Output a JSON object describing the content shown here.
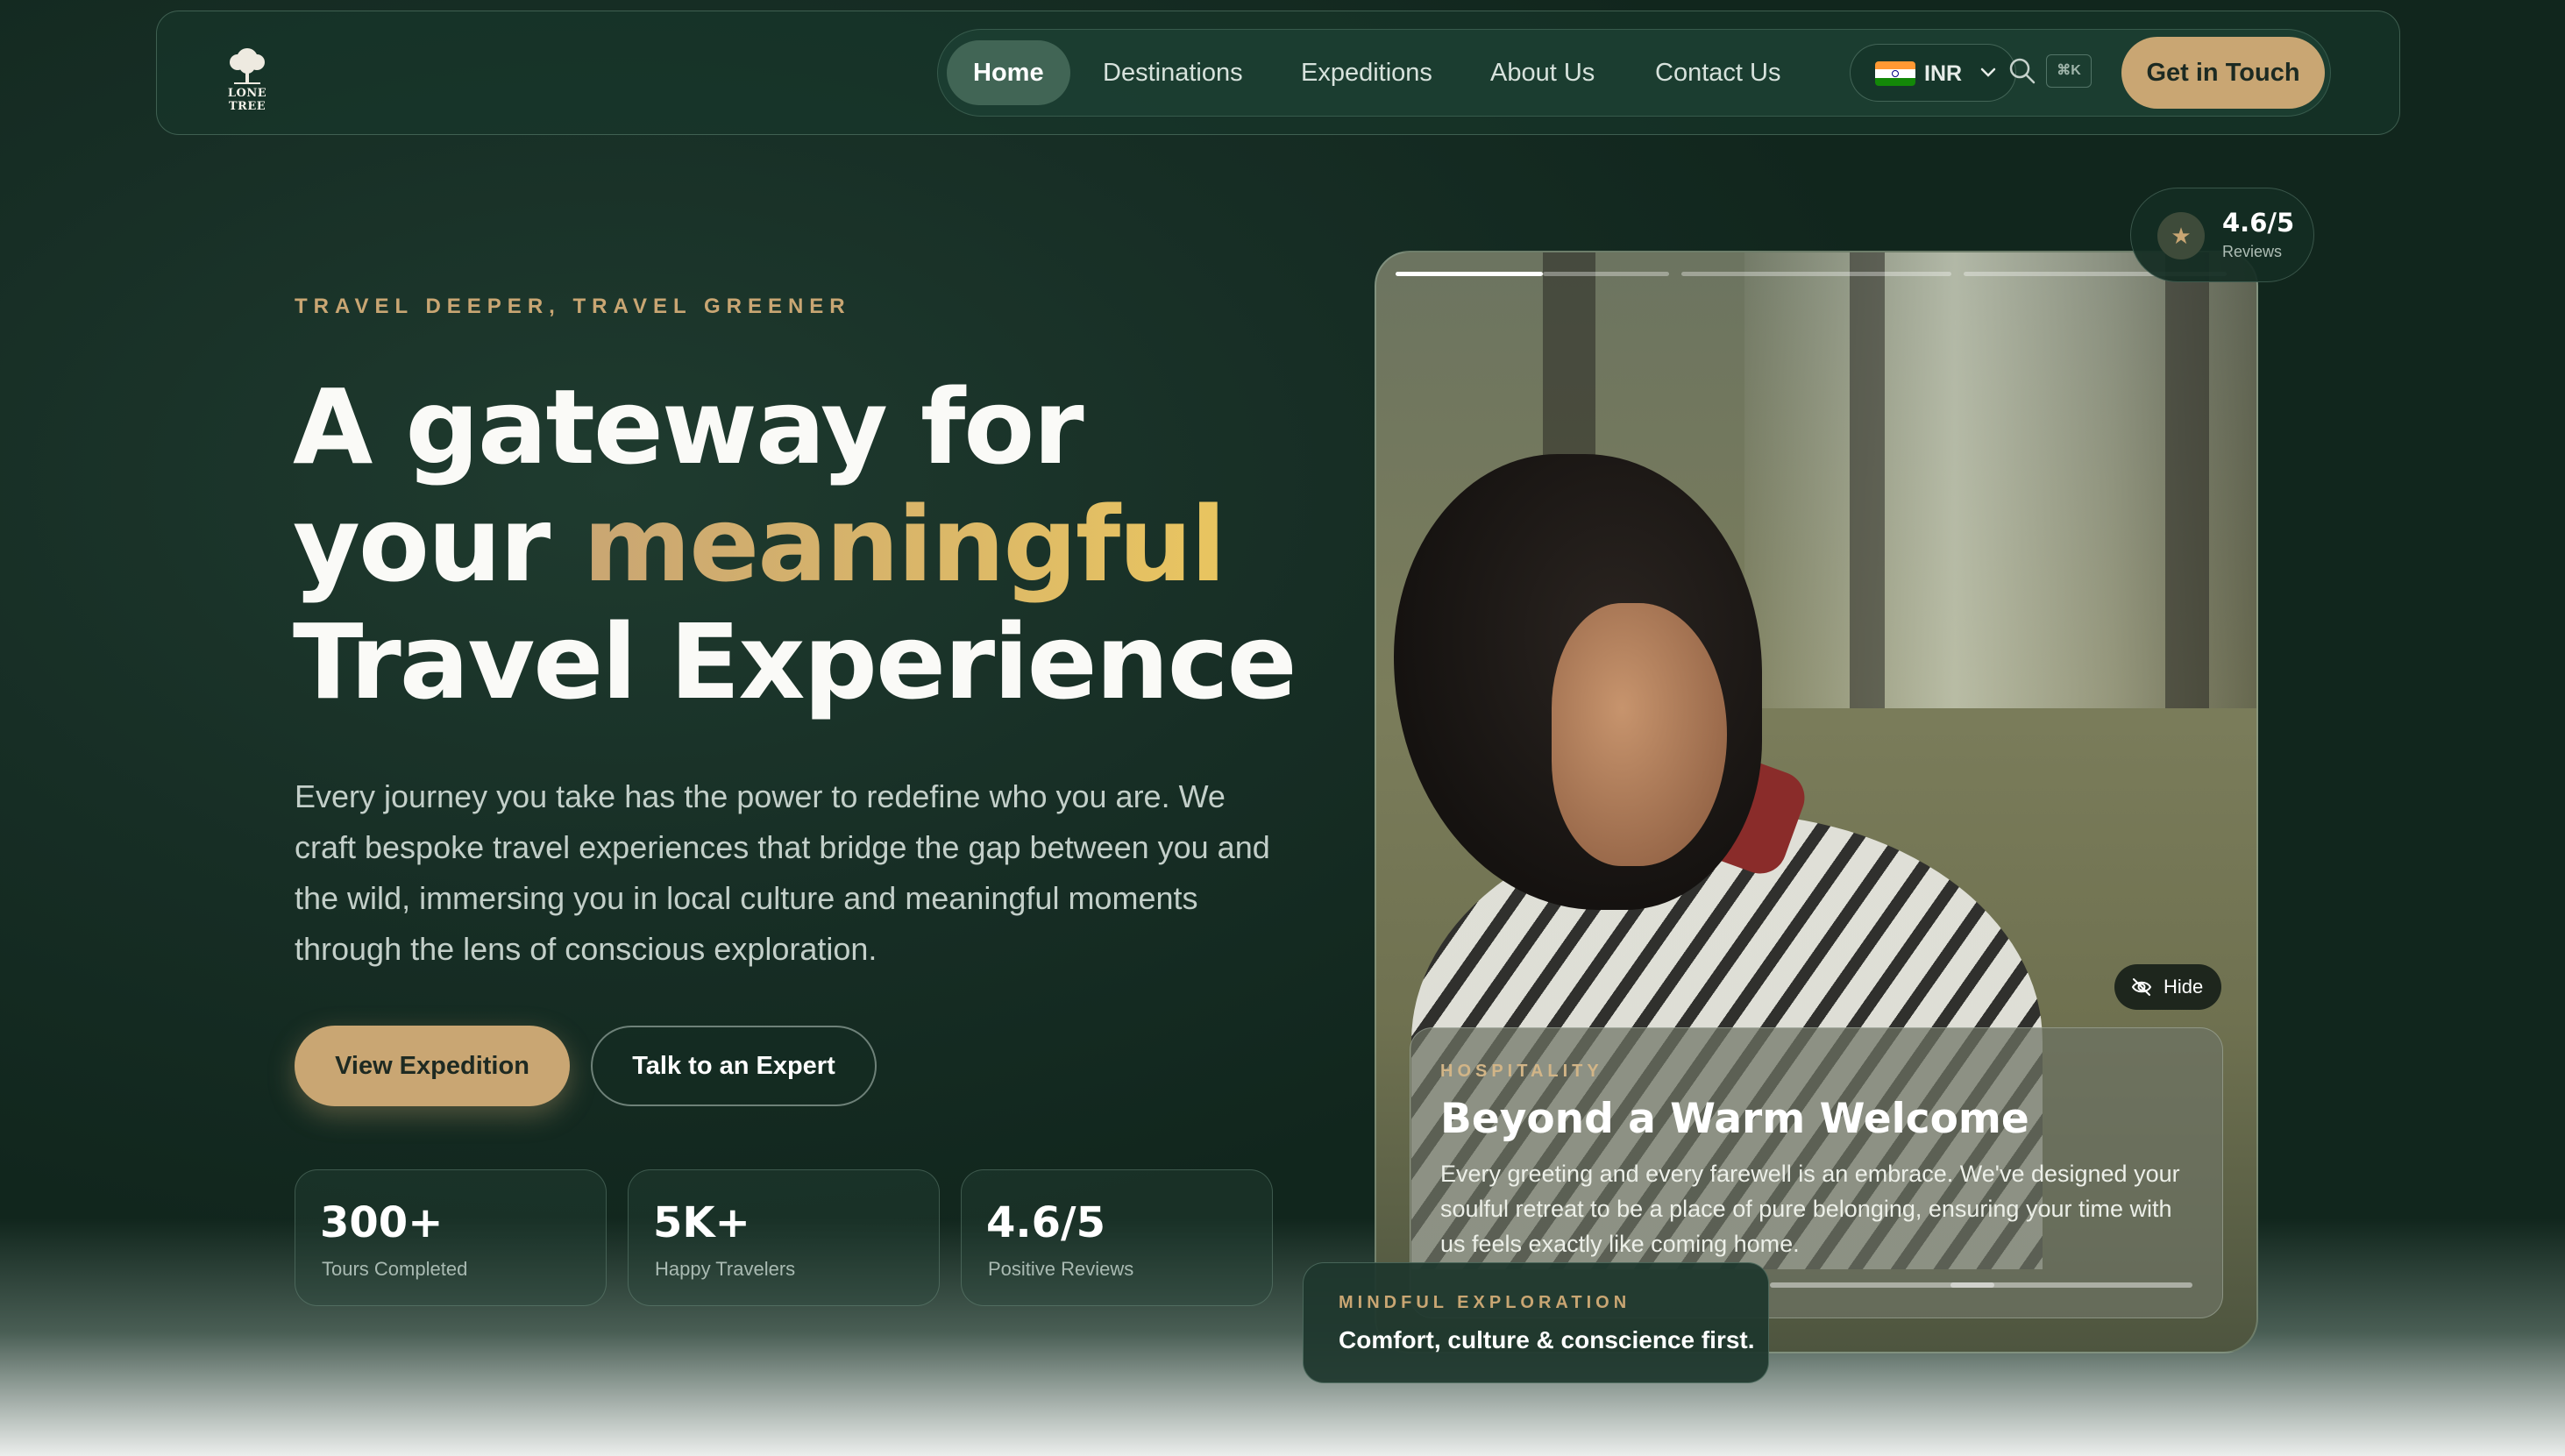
{
  "nav": {
    "logo_text": "LONE TREE",
    "items": [
      {
        "label": "Home",
        "active": true
      },
      {
        "label": "Destinations"
      },
      {
        "label": "Expeditions"
      },
      {
        "label": "About Us"
      },
      {
        "label": "Contact Us"
      }
    ],
    "currency": "INR",
    "search_shortcut": "⌘K",
    "cta": "Get in Touch"
  },
  "hero": {
    "eyebrow": "TRAVEL DEEPER, TRAVEL GREENER",
    "headline_line1": "A gateway for",
    "headline_line2_prefix": "your ",
    "headline_line2_highlight": "meaningful",
    "headline_line3": "Travel Experience",
    "description": "Every journey you take has the power to redefine who you are. We craft bespoke travel experiences that bridge the gap between you and the wild, immersing you in local culture and meaningful moments through the lens of conscious exploration.",
    "primary_button": "View Expedition",
    "secondary_button": "Talk to an Expert",
    "stats": [
      {
        "value": "300+",
        "label": "Tours Completed"
      },
      {
        "value": "5K+",
        "label": "Happy Travelers"
      },
      {
        "value": "4.6/5",
        "label": "Positive Reviews"
      }
    ]
  },
  "showcase": {
    "rating_value": "4.6/5",
    "rating_label": "Reviews",
    "hide_label": "Hide",
    "slide_count": 4,
    "active_slide": 1,
    "card_tag": "HOSPITALITY",
    "card_title": "Beyond a Warm Welcome",
    "card_body": "Every greeting and every farewell is an embrace. We've designed your soulful retreat to be a place of pure belonging, ensuring your time with us feels exactly like coming home.",
    "mindful_tag": "MINDFUL EXPLORATION",
    "mindful_text": "Comfort, culture & conscience first."
  },
  "colors": {
    "accent_gold": "#c9a673",
    "highlight_gold": "#e9c560",
    "background_green": "#172e25"
  }
}
